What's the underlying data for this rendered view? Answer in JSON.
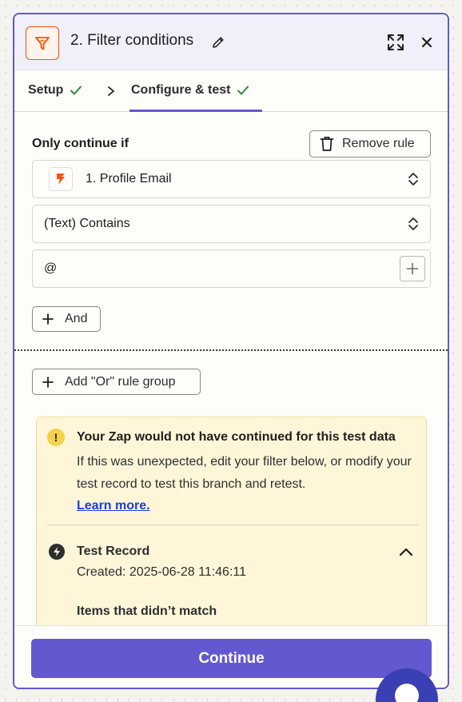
{
  "header": {
    "title": "2. Filter conditions"
  },
  "tabs": [
    {
      "label": "Setup"
    },
    {
      "label": "Configure & test"
    }
  ],
  "rule": {
    "heading": "Only continue if",
    "remove_label": "Remove rule",
    "field_label": "1. Profile Email",
    "condition_label": "(Text) Contains",
    "value": "@",
    "and_label": "And",
    "or_label": "Add \"Or\" rule group"
  },
  "alert": {
    "title": "Your Zap would not have continued for this test data",
    "body": "If this was unexpected, edit your filter below, or modify your test record to test this branch and retest.",
    "link": "Learn more."
  },
  "record": {
    "title": "Test Record",
    "created": "Created: 2025-06-28 11:46:11",
    "items_label": "Items that didn’t match"
  },
  "footer": {
    "continue_label": "Continue"
  },
  "colors": {
    "accent": "#6358d0",
    "brand": "#ff4f00",
    "success": "#2e8b3d",
    "alert_bg": "#fff6d9"
  }
}
